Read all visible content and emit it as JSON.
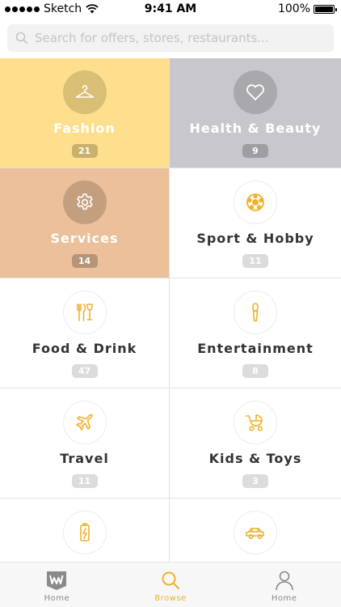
{
  "status_bar": {
    "carrier": "Sketch",
    "time": "9:41 AM",
    "battery": "100%"
  },
  "search": {
    "placeholder": "Search for offers, stores, restaurants..."
  },
  "categories": [
    {
      "label": "Fashion",
      "count": "21",
      "icon": "hanger-icon",
      "style": "filled",
      "bg": "#fddf8e",
      "circle": "#d9be75",
      "badge_bg": "#c9b06b"
    },
    {
      "label": "Health & Beauty",
      "count": "9",
      "icon": "heart-icon",
      "style": "filled",
      "bg": "#c8c7cb",
      "circle": "#a9a8ac",
      "badge_bg": "#9e9da1"
    },
    {
      "label": "Services",
      "count": "14",
      "icon": "gear-icon",
      "style": "filled",
      "bg": "#ebc09a",
      "circle": "#c39f7f",
      "badge_bg": "#b69477"
    },
    {
      "label": "Sport & Hobby",
      "count": "11",
      "icon": "football-icon",
      "style": "light"
    },
    {
      "label": "Food & Drink",
      "count": "47",
      "icon": "cutlery-glass-icon",
      "style": "light"
    },
    {
      "label": "Entertainment",
      "count": "8",
      "icon": "microphone-icon",
      "style": "light"
    },
    {
      "label": "Travel",
      "count": "11",
      "icon": "airplane-icon",
      "style": "light"
    },
    {
      "label": "Kids & Toys",
      "count": "3",
      "icon": "stroller-icon",
      "style": "light"
    },
    {
      "label": "",
      "count": "",
      "icon": "battery-icon",
      "style": "light"
    },
    {
      "label": "",
      "count": "",
      "icon": "car-icon",
      "style": "light"
    }
  ],
  "tab_bar": {
    "items": [
      {
        "label": "Home",
        "icon": "w-logo-icon",
        "active": false
      },
      {
        "label": "Browse",
        "icon": "search-icon",
        "active": true
      },
      {
        "label": "Home",
        "icon": "person-icon",
        "active": false
      }
    ]
  },
  "colors": {
    "accent": "#f0b12b",
    "inactive_tab": "#8a8a8a",
    "light_badge": "#dcdcdc"
  }
}
